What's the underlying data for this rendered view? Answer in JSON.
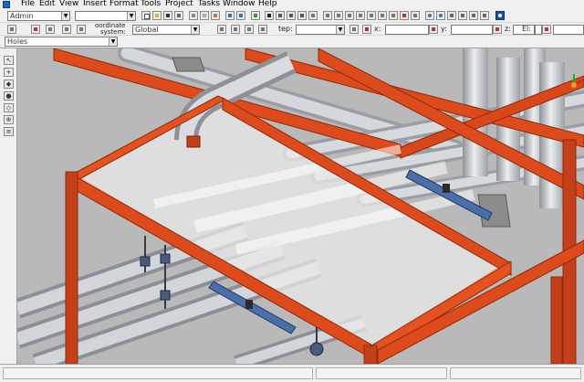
{
  "menu": [
    "File",
    "Edit",
    "View",
    "Insert",
    "Format",
    "Tools",
    "Project",
    "Tasks",
    "Window",
    "Help"
  ],
  "toolbar": {
    "permission_group": "Admin",
    "second_combo": "",
    "coordinate_label_1": "oordinate",
    "coordinate_label_2": "system:",
    "coordinate_system": "Global",
    "step_label": "tep:",
    "x_label": "x:",
    "y_label": "y:",
    "z_label": "z:",
    "el_label": "El:"
  },
  "filter": {
    "value": "Holes"
  },
  "icons": [
    "new-icon",
    "open-icon",
    "save-icon",
    "print-icon",
    "cut-icon",
    "copy-icon",
    "paste-icon",
    "undo-icon",
    "redo-icon",
    "refresh-icon",
    "select-icon",
    "move-icon",
    "rotate-icon",
    "measure-icon",
    "zoom-in-icon",
    "zoom-out-icon",
    "pan-icon",
    "fit-view-icon",
    "walk-icon",
    "fly-icon",
    "help-icon"
  ],
  "colors": {
    "steel": "#dd4a1c",
    "steel_dark": "#8f2a0c",
    "pipe": "#cfd2d6",
    "pipe_dark": "#9ea2a8",
    "background": "#b9b9b9",
    "hanger": "#4a6fa8"
  }
}
